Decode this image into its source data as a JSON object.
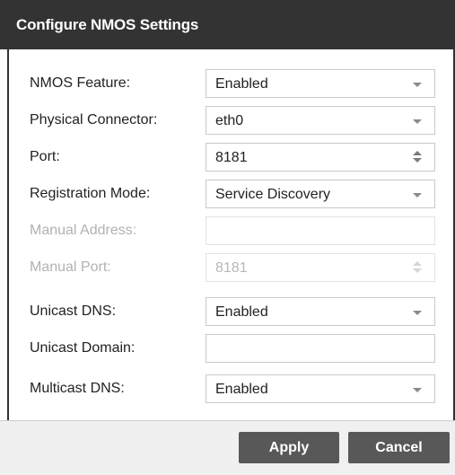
{
  "dialog": {
    "title": "Configure NMOS Settings"
  },
  "fields": [
    {
      "label": "NMOS Feature:",
      "type": "select",
      "value": "Enabled",
      "disabled": false
    },
    {
      "label": "Physical Connector:",
      "type": "select",
      "value": "eth0",
      "disabled": false
    },
    {
      "label": "Port:",
      "type": "number",
      "value": "8181",
      "disabled": false
    },
    {
      "label": "Registration Mode:",
      "type": "select",
      "value": "Service Discovery",
      "disabled": false
    },
    {
      "label": "Manual Address:",
      "type": "text",
      "value": "",
      "disabled": true
    },
    {
      "label": "Manual Port:",
      "type": "number",
      "value": "8181",
      "disabled": true
    },
    {
      "label": "Unicast DNS:",
      "type": "select",
      "value": "Enabled",
      "disabled": false
    },
    {
      "label": "Unicast Domain:",
      "type": "text",
      "value": "",
      "disabled": false
    },
    {
      "label": "Multicast DNS:",
      "type": "select",
      "value": "Enabled",
      "disabled": false
    }
  ],
  "buttons": {
    "apply": "Apply",
    "cancel": "Cancel"
  },
  "colors": {
    "titlebar": "#333333",
    "button": "#585858",
    "footer": "#f0f0f0"
  }
}
